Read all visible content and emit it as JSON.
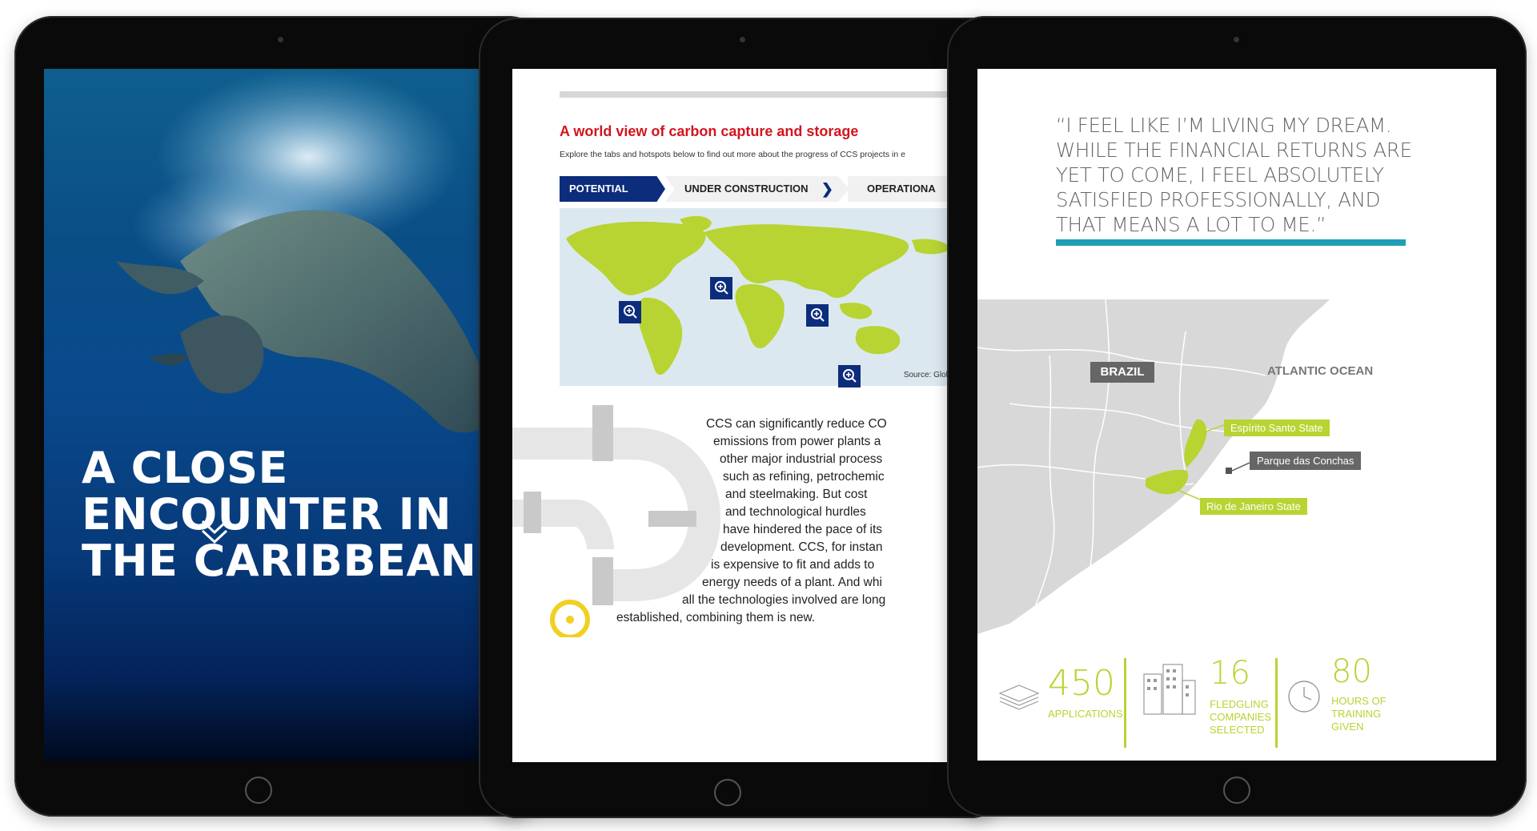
{
  "tablet1": {
    "title_lines": [
      "A CLOSE",
      "ENCOUNTER IN",
      "THE CARIBBEAN"
    ],
    "scroll_icon": "double-chevron-down-icon"
  },
  "tablet2": {
    "title": "A world view of carbon capture and storage",
    "subtitle": "Explore the tabs and hotspots below to find out more about the progress of CCS projects in e",
    "tabs": [
      {
        "label": "POTENTIAL",
        "active": true
      },
      {
        "label": "UNDER CONSTRUCTION",
        "active": false
      },
      {
        "label": "OPERATIONA",
        "active": false
      }
    ],
    "map_source": "Source: Global CCS In",
    "body_lines": [
      "CCS can significantly reduce CO",
      "emissions from power plants a",
      "other major industrial process",
      "such as refining, petrochemic",
      "and steelmaking. But cost",
      "and technological hurdles",
      "have hindered the pace of its",
      "development. CCS, for instan",
      "is expensive to fit and adds to",
      "energy needs of a plant. And whi",
      "all the technologies involved are long",
      "established, combining them is new."
    ],
    "colors": {
      "accent_red": "#d2151f",
      "navy": "#0c2c7c",
      "map_green": "#b7d433"
    }
  },
  "tablet3": {
    "quote_lines": [
      "“I FEEL LIKE I’M LIVING MY DREAM.",
      "WHILE THE FINANCIAL RETURNS ARE",
      "YET TO COME, I FEEL ABSOLUTELY",
      "SATISFIED PROFESSIONALLY, AND",
      "THAT MEANS A LOT TO ME.”"
    ],
    "map_labels": {
      "country": "BRAZIL",
      "ocean": "ATLANTIC OCEAN",
      "espirito": "Espírito Santo State",
      "parque": "Parque das Conchas",
      "rio": "Rio de Janeiro State"
    },
    "stats": [
      {
        "number": "450",
        "label": "APPLICATIONS"
      },
      {
        "number": "16",
        "label_lines": [
          "FLEDGLING",
          "COMPANIES",
          "SELECTED"
        ]
      },
      {
        "number": "80",
        "label_lines": [
          "HOURS OF",
          "TRAINING",
          "GIVEN"
        ]
      }
    ],
    "colors": {
      "teal": "#1e9fb5",
      "lime": "#b7d433",
      "grey_label": "#666666"
    }
  }
}
